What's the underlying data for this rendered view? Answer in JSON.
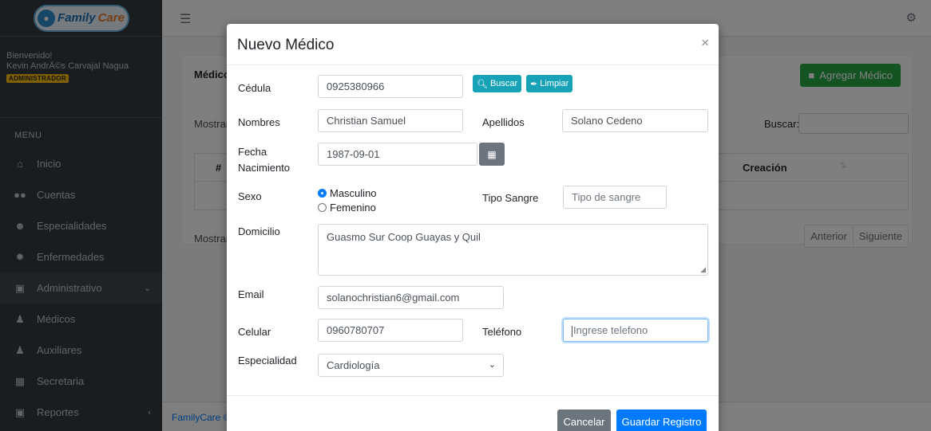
{
  "brand": {
    "family": "Family",
    "care": "Care"
  },
  "user_panel": {
    "welcome": "Bienvenido!",
    "user_name": "Kevin AndrÃ©s Carvajal Nagua",
    "role": "ADMINISTRADOR"
  },
  "sidebar": {
    "menu_header": "MENU",
    "items": [
      {
        "label": "Inicio",
        "icon": "home-icon"
      },
      {
        "label": "Cuentas",
        "icon": "users-icon"
      },
      {
        "label": "Especialidades",
        "icon": "user-md-icon"
      },
      {
        "label": "Enfermedades",
        "icon": "virus-icon"
      },
      {
        "label": "Administrativo",
        "icon": "box-icon"
      },
      {
        "label": "Médicos",
        "icon": "doctor-icon"
      },
      {
        "label": "Auxiliares",
        "icon": "nurse-icon"
      },
      {
        "label": "Secretaria",
        "icon": "id-card-icon"
      },
      {
        "label": "Reportes",
        "icon": "report-icon"
      }
    ]
  },
  "background_page": {
    "card_title": "Médico",
    "add_button": "Agregar Médico",
    "show_label": "Mostrar",
    "search_label": "Buscar:",
    "col_number": "#",
    "col_creation": "Creación",
    "show_info": "Mostrar",
    "pager_prev": "Anterior",
    "pager_next": "Siguiente",
    "footer": "FamilyCare ©"
  },
  "modal": {
    "title": "Nuevo Médico",
    "close_symbol": "×",
    "cedula_label": "Cédula",
    "cedula_value": "0925380966",
    "buscar_label": "Buscar",
    "limpiar_label": "Limpiar",
    "nombres_label": "Nombres",
    "nombres_value": "Christian Samuel",
    "apellidos_label": "Apellidos",
    "apellidos_value": "Solano Cedeno",
    "fecha_label_1": "Fecha",
    "fecha_label_2": "Nacimiento",
    "fecha_value": "1987-09-01",
    "sexo_label": "Sexo",
    "sexo_options": [
      "Masculino",
      "Femenino"
    ],
    "sexo_selected": "Masculino",
    "tipo_sangre_label": "Tipo Sangre",
    "tipo_sangre_placeholder": "Tipo de sangre",
    "domicilio_label": "Domicilio",
    "domicilio_value": "Guasmo Sur Coop Guayas y Quil",
    "email_label": "Email",
    "email_value": "solanochristian6@gmail.com",
    "celular_label": "Celular",
    "celular_value": "0960780707",
    "telefono_label": "Teléfono",
    "telefono_placeholder": "Ingrese telefono",
    "especialidad_label": "Especialidad",
    "especialidad_value": "Cardiología",
    "cancel_button": "Cancelar",
    "save_button": "Guardar Registro"
  },
  "colors": {
    "sidebar_bg": "#343a40",
    "primary": "#007bff",
    "info": "#17a2b8",
    "success": "#28a745",
    "secondary": "#6c757d",
    "role_badge": "#ffc107"
  }
}
